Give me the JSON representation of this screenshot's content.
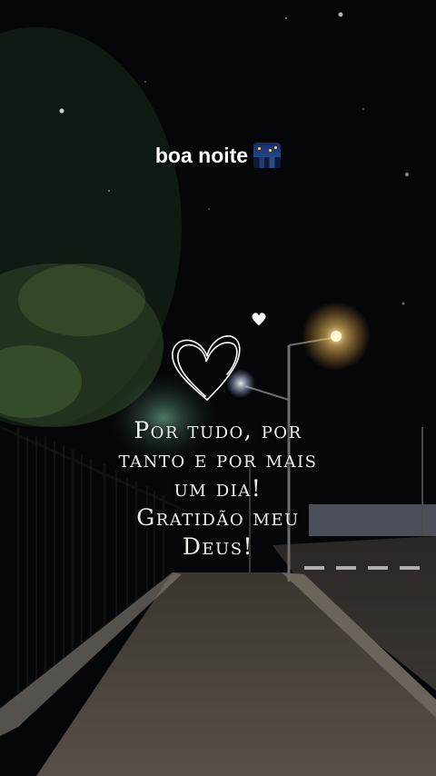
{
  "caption": {
    "text": "boa noite",
    "emoji": "night-city-emoji"
  },
  "quote": {
    "lines": [
      "Por tudo, por",
      "tanto e por mais",
      "um dia!",
      "Gratidão meu",
      "Deus!"
    ]
  },
  "icons": {
    "large": "heart-outline-icon",
    "small": "heart-icon"
  },
  "colors": {
    "text": "#f2f2ef",
    "sky": "#050608",
    "lamp": "#ffd27a"
  }
}
